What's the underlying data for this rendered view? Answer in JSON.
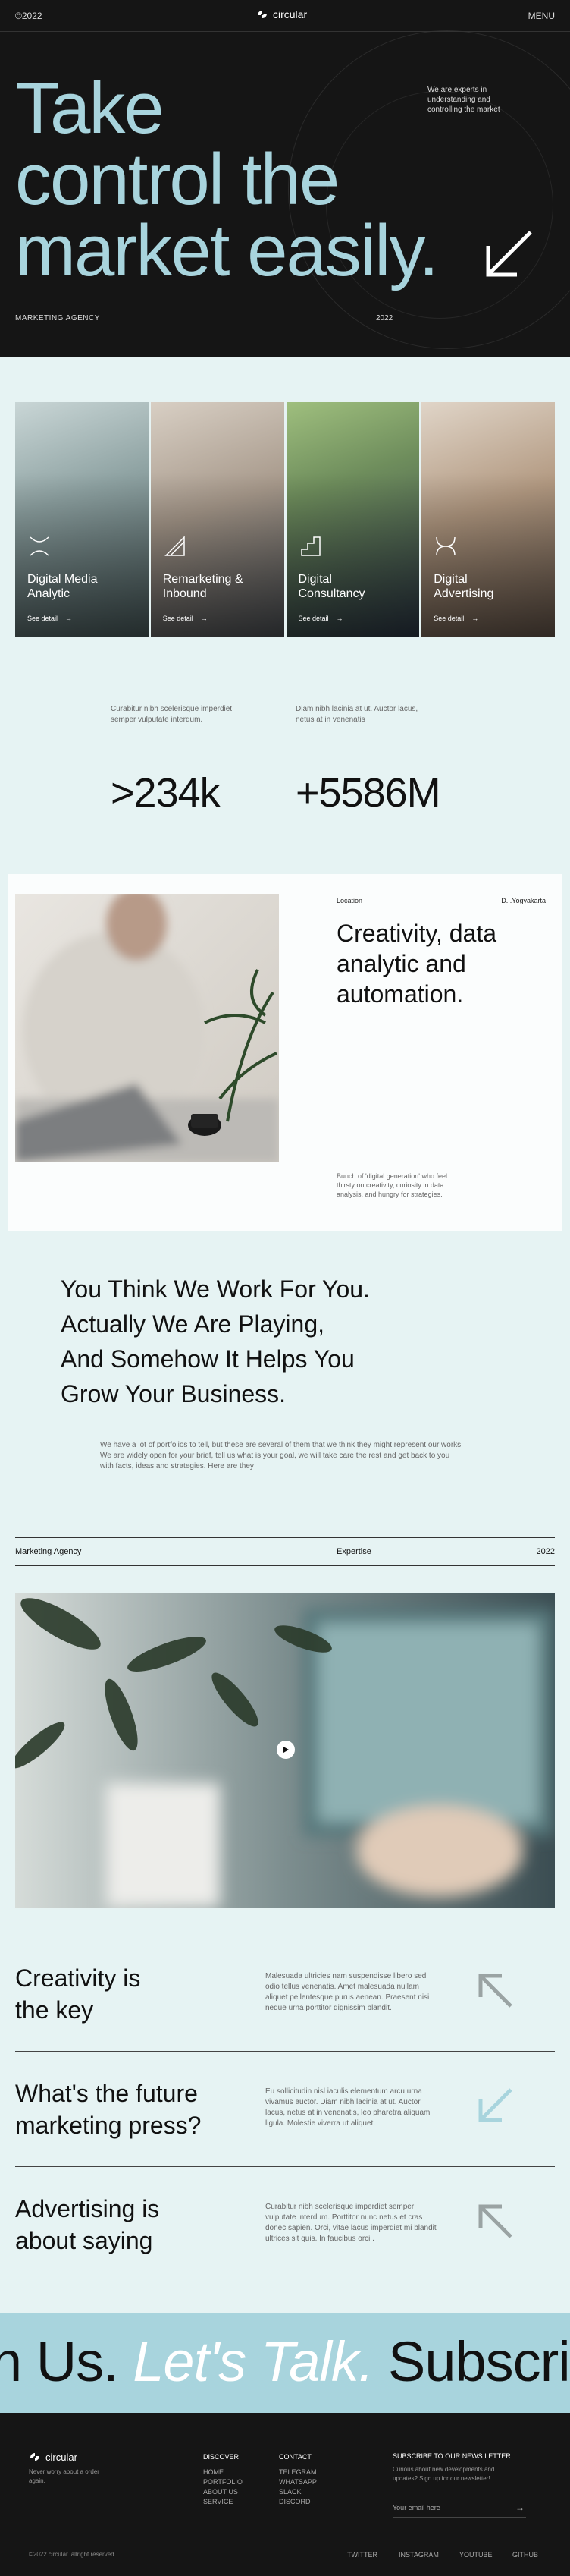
{
  "header": {
    "year": "©2022",
    "logo_text": "circular",
    "menu_label": "MENU"
  },
  "hero": {
    "headline_line1": "Take",
    "headline_line2": "control the",
    "headline_line3": "market easily.",
    "tagline": "We are experts in understanding and controlling the market",
    "agency_label": "MARKETING AGENCY",
    "year_label": "2022",
    "accent_color": "#a8d4dd"
  },
  "services": [
    {
      "title_line1": "Digital Media",
      "title_line2": "Analytic",
      "link": "See detail",
      "icon": "x-shape-icon"
    },
    {
      "title_line1": "Remarketing &",
      "title_line2": "Inbound",
      "link": "See detail",
      "icon": "triangle-icon"
    },
    {
      "title_line1": "Digital",
      "title_line2": "Consultancy",
      "link": "See detail",
      "icon": "stairs-icon"
    },
    {
      "title_line1": "Digital",
      "title_line2": "Advertising",
      "link": "See detail",
      "icon": "double-arc-icon"
    }
  ],
  "stats": {
    "note1": "Curabitur nibh scelerisque imperdiet semper vulputate interdum.",
    "note2": "Diam nibh lacinia at ut. Auctor lacus, netus at in venenatis",
    "value1": ">234k",
    "value2": "+5586M"
  },
  "creativity": {
    "location_label": "Location",
    "city": "D.I.Yogyakarta",
    "heading": "Creativity, data analytic and automation.",
    "description": "Bunch of 'digital generation' who feel thirsty on creativity, curiosity in data analysis, and hungry for strategies."
  },
  "think": {
    "line1": "You Think We Work For You.",
    "line2": "Actually We Are Playing,",
    "line3": "And Somehow It Helps You",
    "line4": "Grow Your Business.",
    "paragraph": "We have a lot of portfolios to tell, but these are several of them that we think they might represent our works. We are widely open for your brief, tell us what is your goal, we will take care the rest and get back to you with facts, ideas and strategies. Here are they"
  },
  "infobar": {
    "left": "Marketing Agency",
    "center": "Expertise",
    "right": "2022"
  },
  "rows": [
    {
      "title_line1": "Creativity is",
      "title_line2": "the key",
      "text": "Malesuada ultricies nam suspendisse libero sed odio tellus venenatis. Amet malesuada nullam aliquet pellentesque purus aenean. Praesent nisi neque urna porttitor dignissim blandit."
    },
    {
      "title_line1": "What's the future",
      "title_line2": "marketing press?",
      "text": "Eu sollicitudin nisl iaculis elementum arcu urna vivamus auctor. Diam nibh lacinia at ut. Auctor lacus, netus at in venenatis, leo pharetra aliquam ligula. Molestie viverra ut aliquet."
    },
    {
      "title_line1": "Advertising is",
      "title_line2": "about saying",
      "text": "Curabitur nibh scelerisque imperdiet semper vulputate interdum. Porttitor nunc netus et cras donec sapien. Orci, vitae lacus imperdiet mi blandit ultrices sit quis. In faucibus orci ."
    }
  ],
  "marquee": {
    "part1": "n Us.",
    "part2": "Let's Talk.",
    "part3": "Subscrib"
  },
  "footer": {
    "logo_text": "circular",
    "sub": "Never worry about a order again.",
    "discover_title": "DISCOVER",
    "discover": [
      "HOME",
      "PORTFOLIO",
      "ABOUT US",
      "SERVICE"
    ],
    "contact_title": "CONTACT",
    "contact": [
      "TELEGRAM",
      "WHATSAPP",
      "SLACK",
      "DISCORD"
    ],
    "news_title": "SUBSCRIBE TO OUR NEWS LETTER",
    "news_text": "Curious about new developments and updates? Sign up for our newsletter!",
    "email_placeholder": "Your email here",
    "copyright": "©2022 circular. allright reserved",
    "social": [
      "TWITTER",
      "INSTAGRAM",
      "YOUTUBE",
      "GITHUB"
    ]
  }
}
